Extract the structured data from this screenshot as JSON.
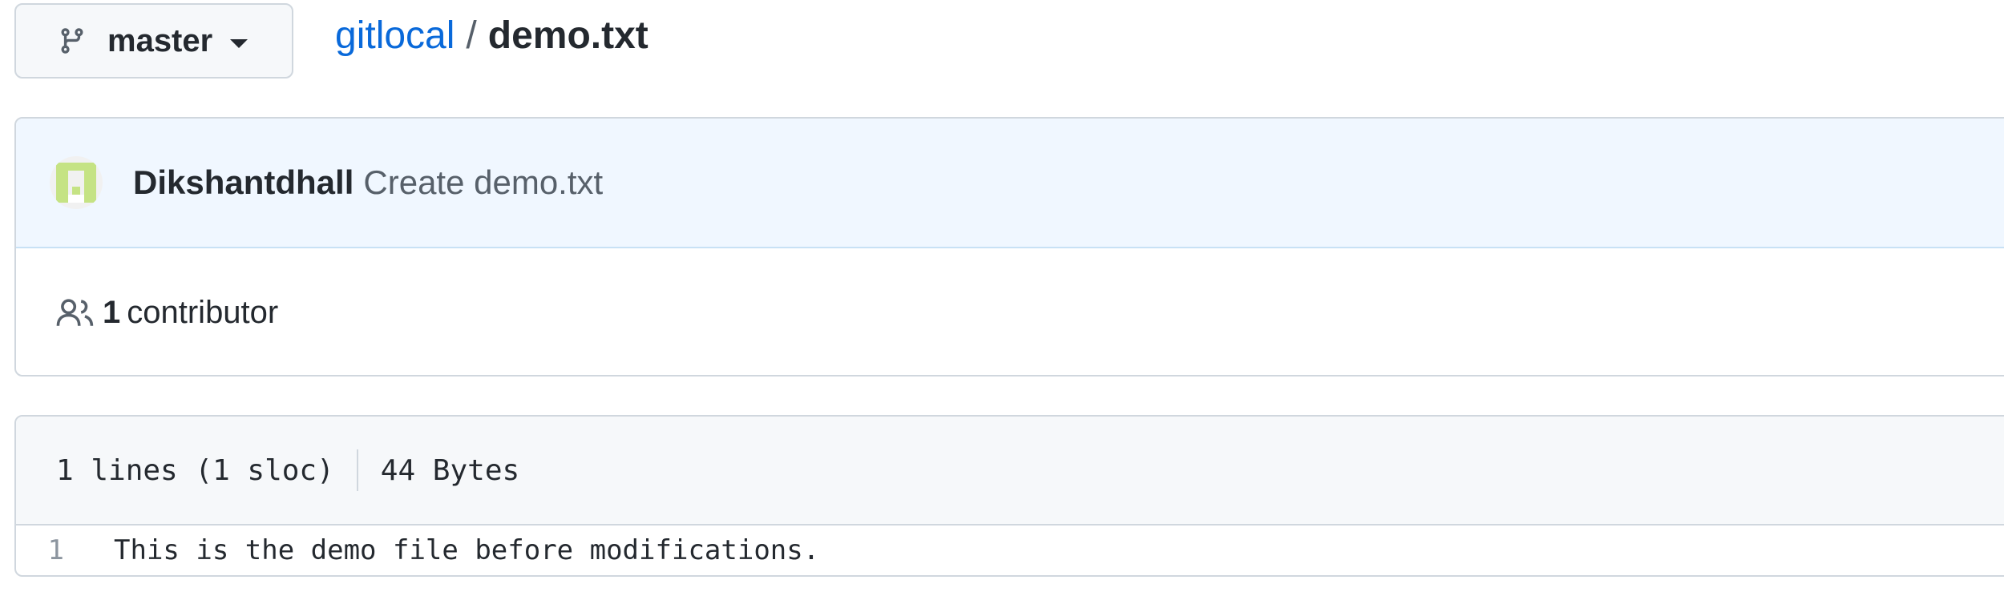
{
  "branch": {
    "name": "master",
    "icon": "git-branch-icon"
  },
  "breadcrumb": {
    "repo": "gitlocal",
    "separator": "/",
    "file": "demo.txt"
  },
  "commit": {
    "author": "Dikshantdhall",
    "message": "Create demo.txt",
    "avatar_icon": "identicon-avatar",
    "avatar_color": "#c5e384"
  },
  "contributors": {
    "icon": "people-icon",
    "count": "1",
    "label": "contributor"
  },
  "file_info": {
    "lines": "1 lines (1 sloc)",
    "size": "44 Bytes"
  },
  "code": {
    "lines": [
      {
        "number": "1",
        "text": "This is the demo file before modifications."
      }
    ]
  }
}
